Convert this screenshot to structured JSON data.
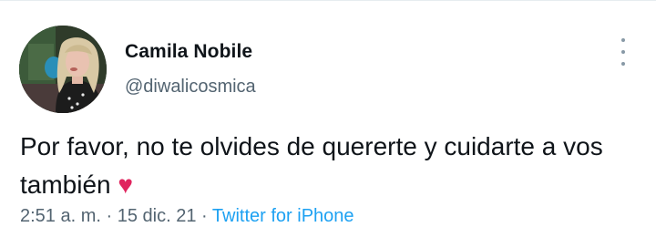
{
  "tweet": {
    "author": {
      "display_name": "Camila Nobile",
      "handle": "@diwalicosmica"
    },
    "text": "Por favor, no te olvides de quererte y cuidarte a vos también",
    "emoji": "♥",
    "meta": {
      "time": "2:51 a. m.",
      "separator": "·",
      "date": "15 dic. 21",
      "source": "Twitter for iPhone"
    }
  },
  "icons": {
    "more": "more-vertical-icon",
    "heart": "heart-emoji-icon"
  },
  "colors": {
    "name": "#0f1419",
    "secondary": "#536471",
    "heart": "#e0245e",
    "link": "#1da1f2"
  }
}
